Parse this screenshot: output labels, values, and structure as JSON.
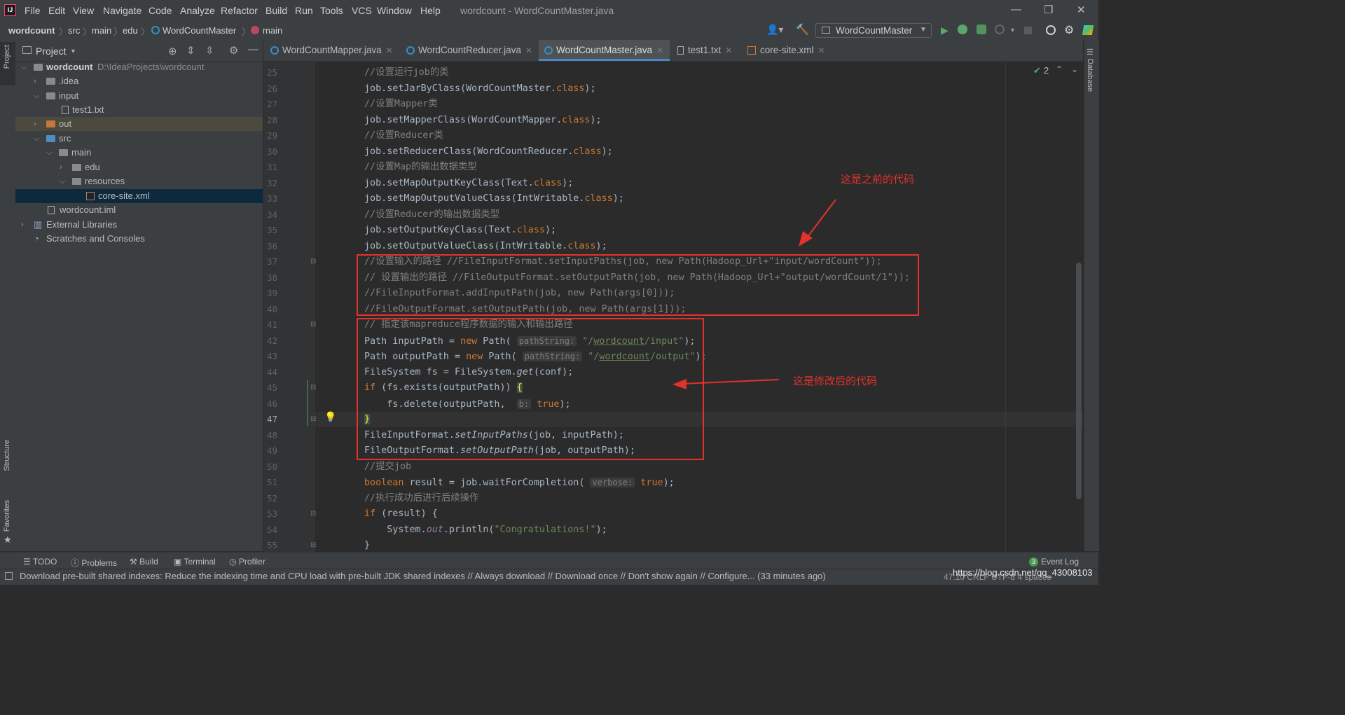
{
  "window": {
    "title": "wordcount - WordCountMaster.java",
    "app_icon": "IJ",
    "controls": [
      "—",
      "❐",
      "✕"
    ]
  },
  "menu": [
    "File",
    "Edit",
    "View",
    "Navigate",
    "Code",
    "Analyze",
    "Refactor",
    "Build",
    "Run",
    "Tools",
    "VCS",
    "Window",
    "Help"
  ],
  "breadcrumb": [
    "wordcount",
    "src",
    "main",
    "edu",
    "WordCountMaster",
    "main"
  ],
  "run_config": "WordCountMaster",
  "left_strip": {
    "project": "Project",
    "structure": "Structure",
    "favorites": "Favorites"
  },
  "right_strip": {
    "database": "Database"
  },
  "project_panel": {
    "title": "Project",
    "tree": [
      {
        "label": "wordcount",
        "path": "D:\\IdeaProjects\\wordcount"
      },
      {
        "label": ".idea"
      },
      {
        "label": "input"
      },
      {
        "label": "test1.txt"
      },
      {
        "label": "out"
      },
      {
        "label": "src"
      },
      {
        "label": "main"
      },
      {
        "label": "edu"
      },
      {
        "label": "resources"
      },
      {
        "label": "core-site.xml"
      },
      {
        "label": "wordcount.iml"
      },
      {
        "label": "External Libraries"
      },
      {
        "label": "Scratches and Consoles"
      }
    ]
  },
  "tabs": [
    "WordCountMapper.java",
    "WordCountReducer.java",
    "WordCountMaster.java",
    "test1.txt",
    "core-site.xml"
  ],
  "editor": {
    "inspection_count": "2",
    "line_numbers": [
      "25",
      "26",
      "27",
      "28",
      "29",
      "30",
      "31",
      "32",
      "33",
      "34",
      "35",
      "36",
      "37",
      "38",
      "39",
      "40",
      "41",
      "42",
      "43",
      "44",
      "45",
      "46",
      "47",
      "48",
      "49",
      "50",
      "51",
      "52",
      "53",
      "54",
      "55"
    ],
    "annotations": {
      "before": "这是之前的代码",
      "after": "这是修改后的代码"
    }
  },
  "bottom_tools": [
    "TODO",
    "Problems",
    "Build",
    "Terminal",
    "Profiler",
    "Event Log"
  ],
  "event_log_badge": "3",
  "status": {
    "message": "Download pre-built shared indexes: Reduce the indexing time and CPU load with pre-built JDK shared indexes // Always download // Download once // Don't show again // Configure... (33 minutes ago)",
    "right": "47:10  CRLF  UTF-8  4 spaces",
    "watermark": "https://blog.csdn.net/qq_43008103"
  },
  "colors": {
    "annotation": "#e5312b",
    "keyword": "#cc7832",
    "comment": "#808080",
    "string": "#6a8759",
    "active_tab_underline": "#4a88c7"
  }
}
